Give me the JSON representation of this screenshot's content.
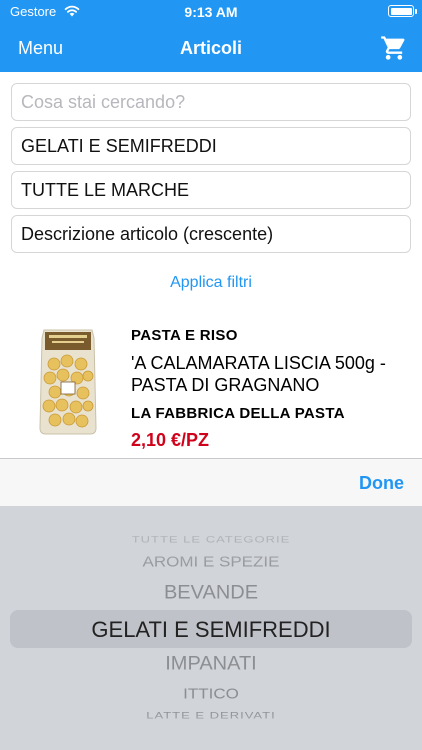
{
  "status_bar": {
    "carrier": "Gestore",
    "time": "9:13 AM"
  },
  "nav": {
    "menu_label": "Menu",
    "title": "Articoli",
    "cart_icon": "cart-icon"
  },
  "filters": {
    "search_placeholder": "Cosa stai cercando?",
    "category": "GELATI E SEMIFREDDI",
    "brand": "TUTTE LE MARCHE",
    "sort": "Descrizione articolo (crescente)",
    "apply_label": "Applica filtri"
  },
  "product": {
    "category": "PASTA E RISO",
    "name": "'A CALAMARATA LISCIA 500g - PASTA DI GRAGNANO",
    "brand": "LA FABBRICA DELLA PASTA",
    "price": "2,10 €/PZ",
    "price_color": "#d0021b"
  },
  "picker": {
    "done_label": "Done",
    "options": [
      "TUTTE LE CATEGORIE",
      "AROMI E SPEZIE",
      "BEVANDE",
      "GELATI E SEMIFREDDI",
      "IMPANATI",
      "ITTICO",
      "LATTE E DERIVATI"
    ],
    "selected_index": 3
  },
  "colors": {
    "accent": "#2196f3",
    "price": "#d0021b"
  }
}
